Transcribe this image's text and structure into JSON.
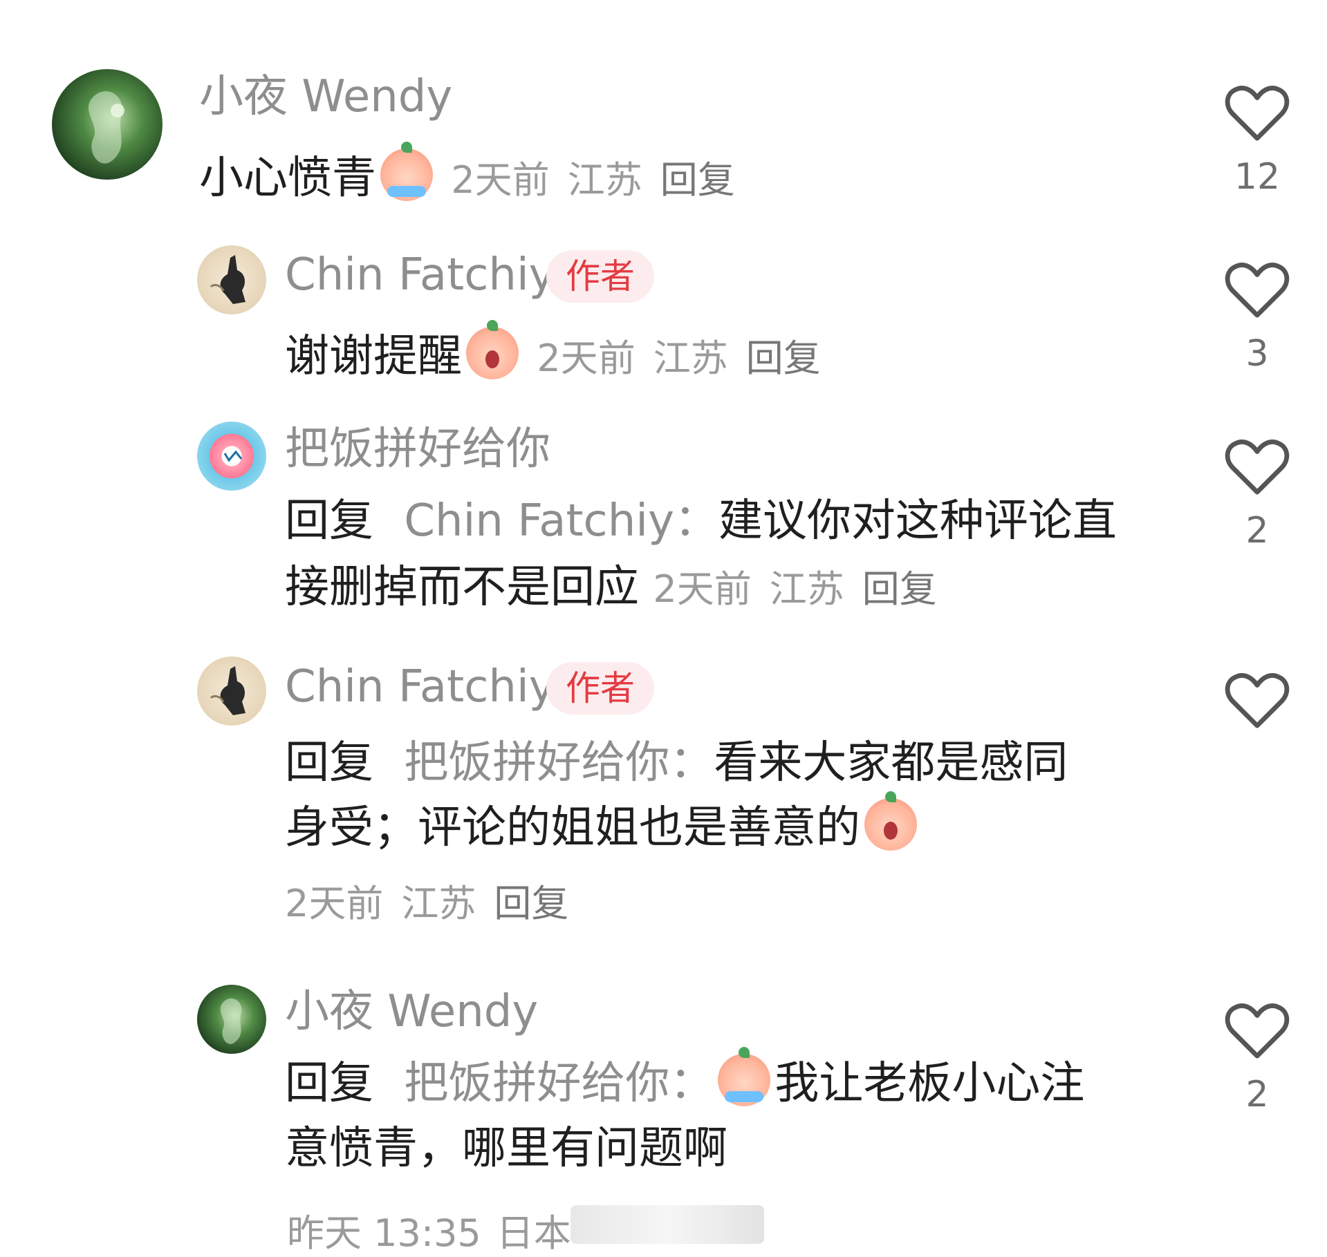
{
  "comments": [
    {
      "user": "小夜 Wendy",
      "avatar": "green-forest-avatar",
      "text": "小心愤青",
      "emoji": "cry-emoji",
      "time": "2天前",
      "location": "江苏",
      "reply": "回复",
      "likes": "12"
    },
    {
      "user": "Chin Fatchiy",
      "avatar": "rabbit-hand-avatar",
      "badge": "作者",
      "text": "谢谢提醒",
      "emoji": "shock-emoji",
      "time": "2天前",
      "location": "江苏",
      "reply": "回复",
      "likes": "3"
    },
    {
      "user": "把饭拼好给你",
      "avatar": "donut-avatar",
      "reply_prefix": "回复",
      "reply_to": "Chin Fatchiy：",
      "text_line1": "建议你对这种评论直",
      "text_line2": "接删掉而不是回应",
      "time": "2天前",
      "location": "江苏",
      "reply": "回复",
      "likes": "2"
    },
    {
      "user": "Chin Fatchiy",
      "avatar": "rabbit-hand-avatar",
      "badge": "作者",
      "reply_prefix": "回复",
      "reply_to": "把饭拼好给你：",
      "text_line1": "看来大家都是感同",
      "text_line2": "身受；评论的姐姐也是善意的",
      "emoji": "shock-emoji",
      "time": "2天前",
      "location": "江苏",
      "reply": "回复",
      "likes": ""
    },
    {
      "user": "小夜 Wendy",
      "avatar": "green-forest-avatar",
      "reply_prefix": "回复",
      "reply_to": "把饭拼好给你：",
      "emoji": "cry-emoji",
      "text_line1": "我让老板小心注",
      "text_line2": "意愤青，哪里有问题啊",
      "time": "昨天 13:35",
      "location": "日本",
      "likes": "2"
    }
  ],
  "colors": {
    "username": "#8e8e8e",
    "text": "#1f1f1f",
    "badge_bg": "#fdeced",
    "badge_text": "#e33b42",
    "meta": "#9a9a9a"
  },
  "icons": {
    "like": "heart-outline-icon"
  }
}
